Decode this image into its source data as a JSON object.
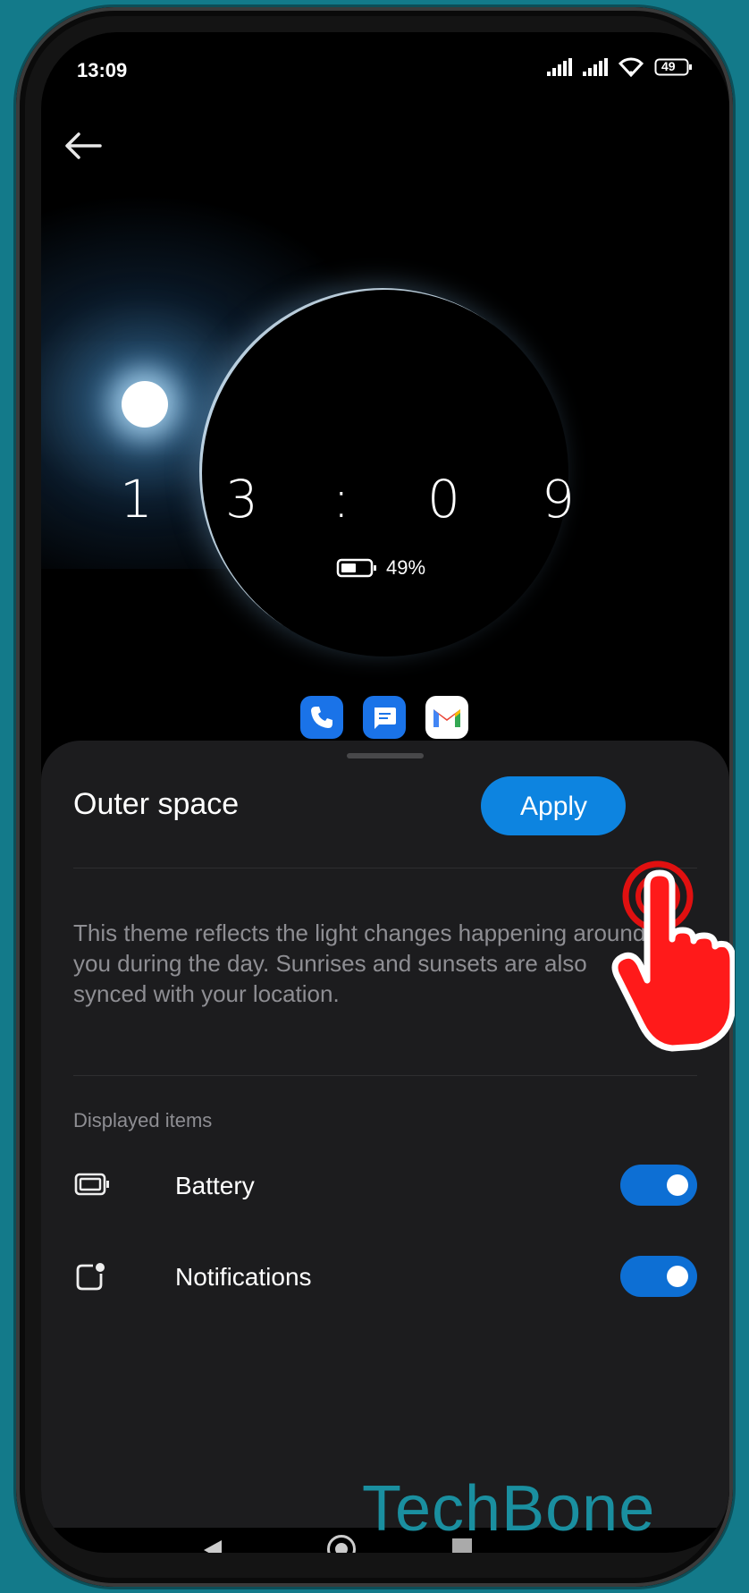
{
  "status_bar": {
    "time": "13:09",
    "battery_level": "49"
  },
  "preview": {
    "clock_digits": [
      "1",
      "3",
      ":",
      "0",
      "9"
    ],
    "battery_percent": "49%"
  },
  "sheet": {
    "title": "Outer space",
    "apply_label": "Apply",
    "description": "This theme reflects the light changes happening around you during the day. Sunrises and sunsets are also synced with your location.",
    "section_label": "Displayed items",
    "items": [
      {
        "label": "Battery",
        "icon": "battery-icon",
        "enabled": true
      },
      {
        "label": "Notifications",
        "icon": "notification-icon",
        "enabled": true
      }
    ]
  },
  "watermark": "TechBone",
  "colors": {
    "accent": "#0d84e0",
    "toggle_on": "#0d6fd4",
    "background": "#137a8a"
  }
}
